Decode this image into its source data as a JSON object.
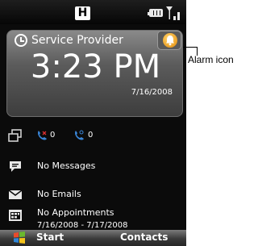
{
  "status_bar": {
    "network_badge": "H"
  },
  "home_card": {
    "provider": "Service Provider",
    "time": "3:23 PM",
    "date": "7/16/2008"
  },
  "calls": {
    "missed_calls": "0",
    "voicemail": "0"
  },
  "messages": {
    "label": "No Messages"
  },
  "emails": {
    "label": "No Emails"
  },
  "appointments": {
    "label": "No Appointments",
    "dates": "7/16/2008 - 7/17/2008"
  },
  "softkeys": {
    "left": "Start",
    "right": "Contacts"
  },
  "callout": {
    "label": "Alarm icon"
  },
  "colors": {
    "background": "#0b0b0b",
    "text": "#ffffff",
    "alarm": "#f0a020",
    "call_icon": "#3a86d8"
  },
  "icons": [
    "H-network-icon",
    "battery-icon",
    "signal-icon",
    "clock-icon",
    "alarm-icon",
    "calls-tab-icon",
    "missed-call-icon",
    "voicemail-icon",
    "message-icon",
    "email-icon",
    "calendar-icon",
    "windows-start-icon"
  ]
}
